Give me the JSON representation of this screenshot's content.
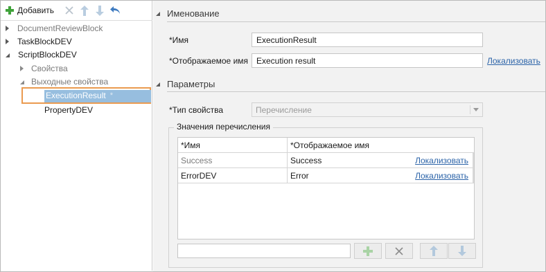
{
  "toolbar": {
    "add_label": "Добавить",
    "add_icon": "plus-icon",
    "delete_icon": "close-icon",
    "up_icon": "arrow-up-icon",
    "down_icon": "arrow-down-icon",
    "undo_icon": "undo-icon"
  },
  "tree": {
    "items": [
      {
        "label": "DocumentReviewBlock"
      },
      {
        "label": "TaskBlockDEV"
      },
      {
        "label": "ScriptBlockDEV"
      },
      {
        "label": "Свойства"
      },
      {
        "label": "Выходные свойства"
      },
      {
        "label": "ExecutionResult",
        "marker": "*"
      },
      {
        "label": "PropertyDEV"
      }
    ]
  },
  "naming": {
    "header": "Именование",
    "name_label": "*Имя",
    "name_value": "ExecutionResult",
    "display_label": "*Отображаемое имя",
    "display_value": "Execution result",
    "localize": "Локализовать"
  },
  "params": {
    "header": "Параметры",
    "type_label": "*Тип свойства",
    "type_value": "Перечисление",
    "group_title": "Значения перечисления",
    "columns": [
      "*Имя",
      "*Отображаемое имя"
    ],
    "rows": [
      {
        "name": "Success",
        "display": "Success",
        "link": "Локализовать"
      },
      {
        "name": "ErrorDEV",
        "display": "Error",
        "link": "Локализовать"
      }
    ],
    "new_value": ""
  },
  "colors": {
    "accent_green": "#3fa23a",
    "link_blue": "#2b63a8",
    "selection_fill": "#97bedf",
    "selection_border": "#ea9a4f"
  }
}
